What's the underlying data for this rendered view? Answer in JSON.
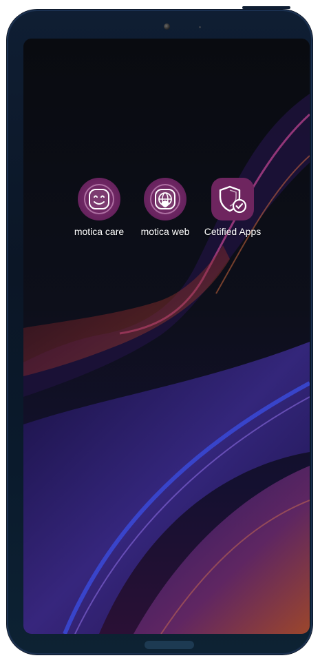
{
  "home_screen": {
    "apps": [
      {
        "label": "motica care",
        "icon": "smiley-icon"
      },
      {
        "label": "motica web",
        "icon": "globe-shield-icon"
      },
      {
        "label": "Cetified Apps",
        "icon": "shield-check-icon"
      }
    ]
  },
  "colors": {
    "app_icon_bg": "#6e255f",
    "phone_frame": "#0f1e33",
    "wallpaper_accent": "#c04a9a"
  }
}
